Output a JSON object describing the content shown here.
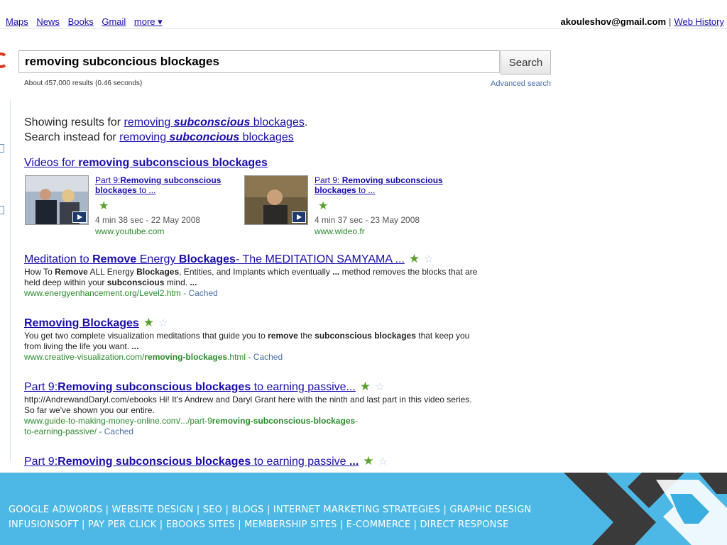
{
  "topnav": {
    "items": [
      "Maps",
      "News",
      "Books",
      "Gmail",
      "more ▾"
    ]
  },
  "account": {
    "email": "akouleshov@gmail.com",
    "separator": "|",
    "web_history": "Web History"
  },
  "search": {
    "query": "removing subconcious blockages",
    "button": "Search"
  },
  "stats": "About 457,000 results (0.46 seconds)",
  "advanced_search": "Advanced search",
  "spelling": {
    "showing_prefix": "Showing results for ",
    "showing_pre": "removing ",
    "showing_bold": "subconscious",
    "showing_post": " blockages",
    "showing_end": ".",
    "instead_prefix": "Search instead for ",
    "instead_pre": "removing ",
    "instead_bold": "subconcious",
    "instead_post": " blockages"
  },
  "videos": {
    "heading_prefix": "Videos for ",
    "heading_bold": "removing subconscious blockages",
    "items": [
      {
        "title_pre": "Part 9:",
        "title_bold": "Removing subconscious blockages",
        "title_post": " to ...",
        "meta": "4 min 38 sec - 22 May 2008",
        "url": "www.youtube.com"
      },
      {
        "title_pre": "Part 9: ",
        "title_bold": "Removing subconscious blockages",
        "title_post": " to ...",
        "meta": "4 min 37 sec - 23 May 2008",
        "url": "www.wideo.fr"
      }
    ]
  },
  "results": [
    {
      "title_parts": [
        "Meditation to ",
        "Remove",
        " Energy ",
        "Blockages",
        "- The MEDITATION SAMYAMA ..."
      ],
      "snippet_parts": [
        "How To ",
        "Remove",
        " ALL Energy ",
        "Blockages",
        ", Entities, and Implants which eventually ",
        "...",
        " method removes the blocks that are held deep within your ",
        "subconscious",
        " mind. ",
        "..."
      ],
      "url": "www.energyenhancement.org/Level2.htm",
      "cached": "Cached"
    },
    {
      "title_parts": [
        "",
        "Removing Blockages"
      ],
      "snippet_parts": [
        "You get two complete visualization meditations that guide you to ",
        "remove",
        " the ",
        "subconscious",
        " ",
        "blockages",
        " that keep you from living the life you want. ",
        "..."
      ],
      "url_parts": [
        "www.creative-visualization.com/",
        "removing-blockages",
        ".html"
      ],
      "cached": "Cached"
    },
    {
      "title_parts": [
        "Part 9:",
        "Removing subconscious blockages",
        " to earning passive..."
      ],
      "snippet": "http://AndrewandDaryl.com/ebooks Hi! It's Andrew and Daryl Grant here with the ninth and last part in this video series. So far we've shown you our entire.",
      "url_parts": [
        "www.guide-to-making-money-online.com/.../part-9",
        "removing-subconscious-blockages",
        "-",
        "to-earning-passive/"
      ],
      "cached": "Cached"
    },
    {
      "title_parts": [
        "Part 9:",
        "Removing subconscious blockages",
        " to earning passive ",
        "..."
      ]
    }
  ],
  "footer": {
    "line1": "GOOGLE ADWORDS | WEBSITE DESIGN | SEO | BLOGS | INTERNET MARKETING STRATEGIES | GRAPHIC DESIGN",
    "line2": "INFUSIONSOFT | PAY PER CLICK | EBOOKS SITES | MEMBERSHIP SITES | E-COMMERCE | DIRECT RESPONSE"
  },
  "colors": {
    "link": "#1a0dab",
    "url_green": "#2c8a2c",
    "footer_bg": "#4db8e6",
    "deco_dark": "#3a3a3a"
  }
}
